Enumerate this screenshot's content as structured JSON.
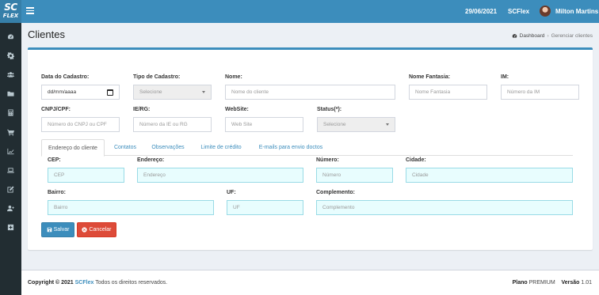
{
  "logo": {
    "line1": "SC",
    "line2": "FLEX"
  },
  "sidebar": {
    "items": [
      {
        "icon": "dashboard-icon"
      },
      {
        "icon": "gear-icon"
      },
      {
        "icon": "users-icon"
      },
      {
        "icon": "folder-icon"
      },
      {
        "icon": "calculator-icon"
      },
      {
        "icon": "cart-icon"
      },
      {
        "icon": "chart-icon"
      },
      {
        "icon": "laptop-icon"
      },
      {
        "icon": "edit-icon"
      },
      {
        "icon": "user-add-icon"
      },
      {
        "icon": "plus-square-icon"
      }
    ]
  },
  "topbar": {
    "date": "29/06/2021",
    "brand": "SCFlex",
    "user": "Milton Martins"
  },
  "header": {
    "title": "Clientes",
    "breadcrumb": [
      "Dashboard",
      "Gerenciar clientes"
    ]
  },
  "form": {
    "data_cadastro": {
      "label": "Data do Cadastro:",
      "value": "dd/mm/aaaa"
    },
    "tipo_cadastro": {
      "label": "Tipo de Cadastro:",
      "value": "Selecione"
    },
    "nome": {
      "label": "Nome:",
      "placeholder": "Nome do cliente"
    },
    "nome_fantasia": {
      "label": "Nome Fantasia:",
      "placeholder": "Nome Fantasia"
    },
    "im": {
      "label": "IM:",
      "placeholder": "Número da IM"
    },
    "cnpj_cpf": {
      "label": "CNPJ/CPF:",
      "placeholder": "Número do CNPJ ou CPF"
    },
    "ie_rg": {
      "label": "IE/RG:",
      "placeholder": "Número da IE ou RG"
    },
    "website": {
      "label": "WebSite:",
      "placeholder": "Web Site"
    },
    "status": {
      "label": "Status(*):",
      "value": "Selecione"
    }
  },
  "tabs": [
    "Endereço do cliente",
    "Contatos",
    "Observações",
    "Limite de crédito",
    "E-mails para envio doctos"
  ],
  "address": {
    "cep": {
      "label": "CEP:",
      "placeholder": "CEP"
    },
    "endereco": {
      "label": "Endereço:",
      "placeholder": "Endereço"
    },
    "numero": {
      "label": "Número:",
      "placeholder": "Número"
    },
    "cidade": {
      "label": "Cidade:",
      "placeholder": "Cidade"
    },
    "bairro": {
      "label": "Bairro:",
      "placeholder": "Bairro"
    },
    "uf": {
      "label": "UF:",
      "placeholder": "UF"
    },
    "complemento": {
      "label": "Complemento:",
      "placeholder": "Complemento"
    }
  },
  "buttons": {
    "save": "Salvar",
    "cancel": "Cancelar"
  },
  "footer": {
    "copyright": "Copyright © 2021",
    "brand": "SCFlex",
    "rights": "Todos os direitos reservados.",
    "plan_label": "Plano",
    "plan_value": "PREMIUM",
    "version_label": "Versão",
    "version_value": "1.01"
  },
  "colors": {
    "header_blue": "#3c8dbc",
    "sidebar_dark": "#222d32",
    "danger": "#dd4b39",
    "cyan_field": "#e8fdfe"
  }
}
